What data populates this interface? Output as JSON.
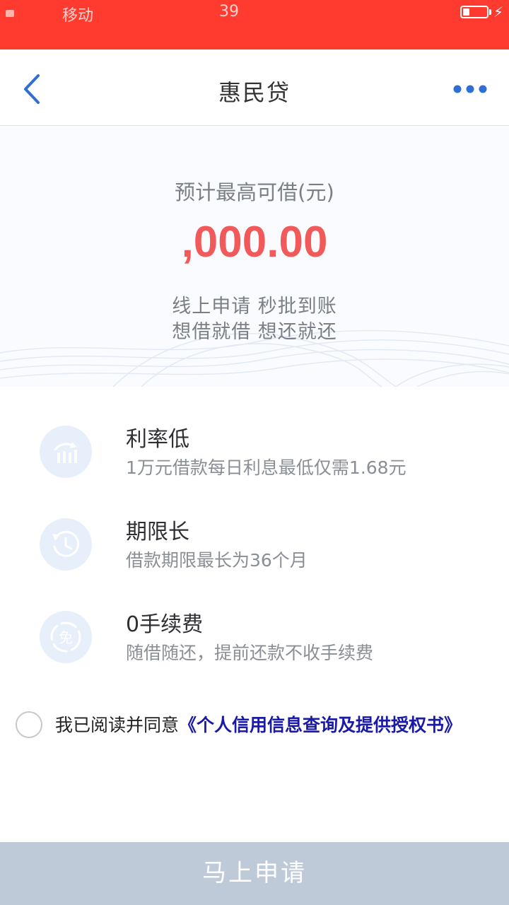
{
  "status_bar": {
    "carrier": "移动",
    "time": "39"
  },
  "nav": {
    "title": "惠民贷",
    "back_icon": "chevron-left-icon",
    "more_icon": "more-dots-icon"
  },
  "hero": {
    "sub_label": "预计最高可借(元)",
    "amount": ",000.00",
    "tagline_1": "线上申请  秒批到账",
    "tagline_2": "想借就借  想还就还"
  },
  "features": [
    {
      "icon": "rate-chart-icon",
      "title": "利率低",
      "desc": "1万元借款每日利息最低仅需1.68元"
    },
    {
      "icon": "clock-icon",
      "title": "期限长",
      "desc": "借款期限最长为36个月"
    },
    {
      "icon": "free-fee-icon",
      "icon_text": "免",
      "title": "0手续费",
      "desc": "随借随还，提前还款不收手续费"
    }
  ],
  "agreement": {
    "prefix": "我已阅读并同意",
    "link": "《个人信用信息查询及提供授权书》"
  },
  "apply_button": {
    "label": "马上申请"
  },
  "colors": {
    "status_bar": "#ff3b30",
    "accent_blue": "#2f6fd0",
    "amount_red": "#f05a5a",
    "button_disabled": "#bfcad8",
    "link": "#1a1aa6"
  }
}
